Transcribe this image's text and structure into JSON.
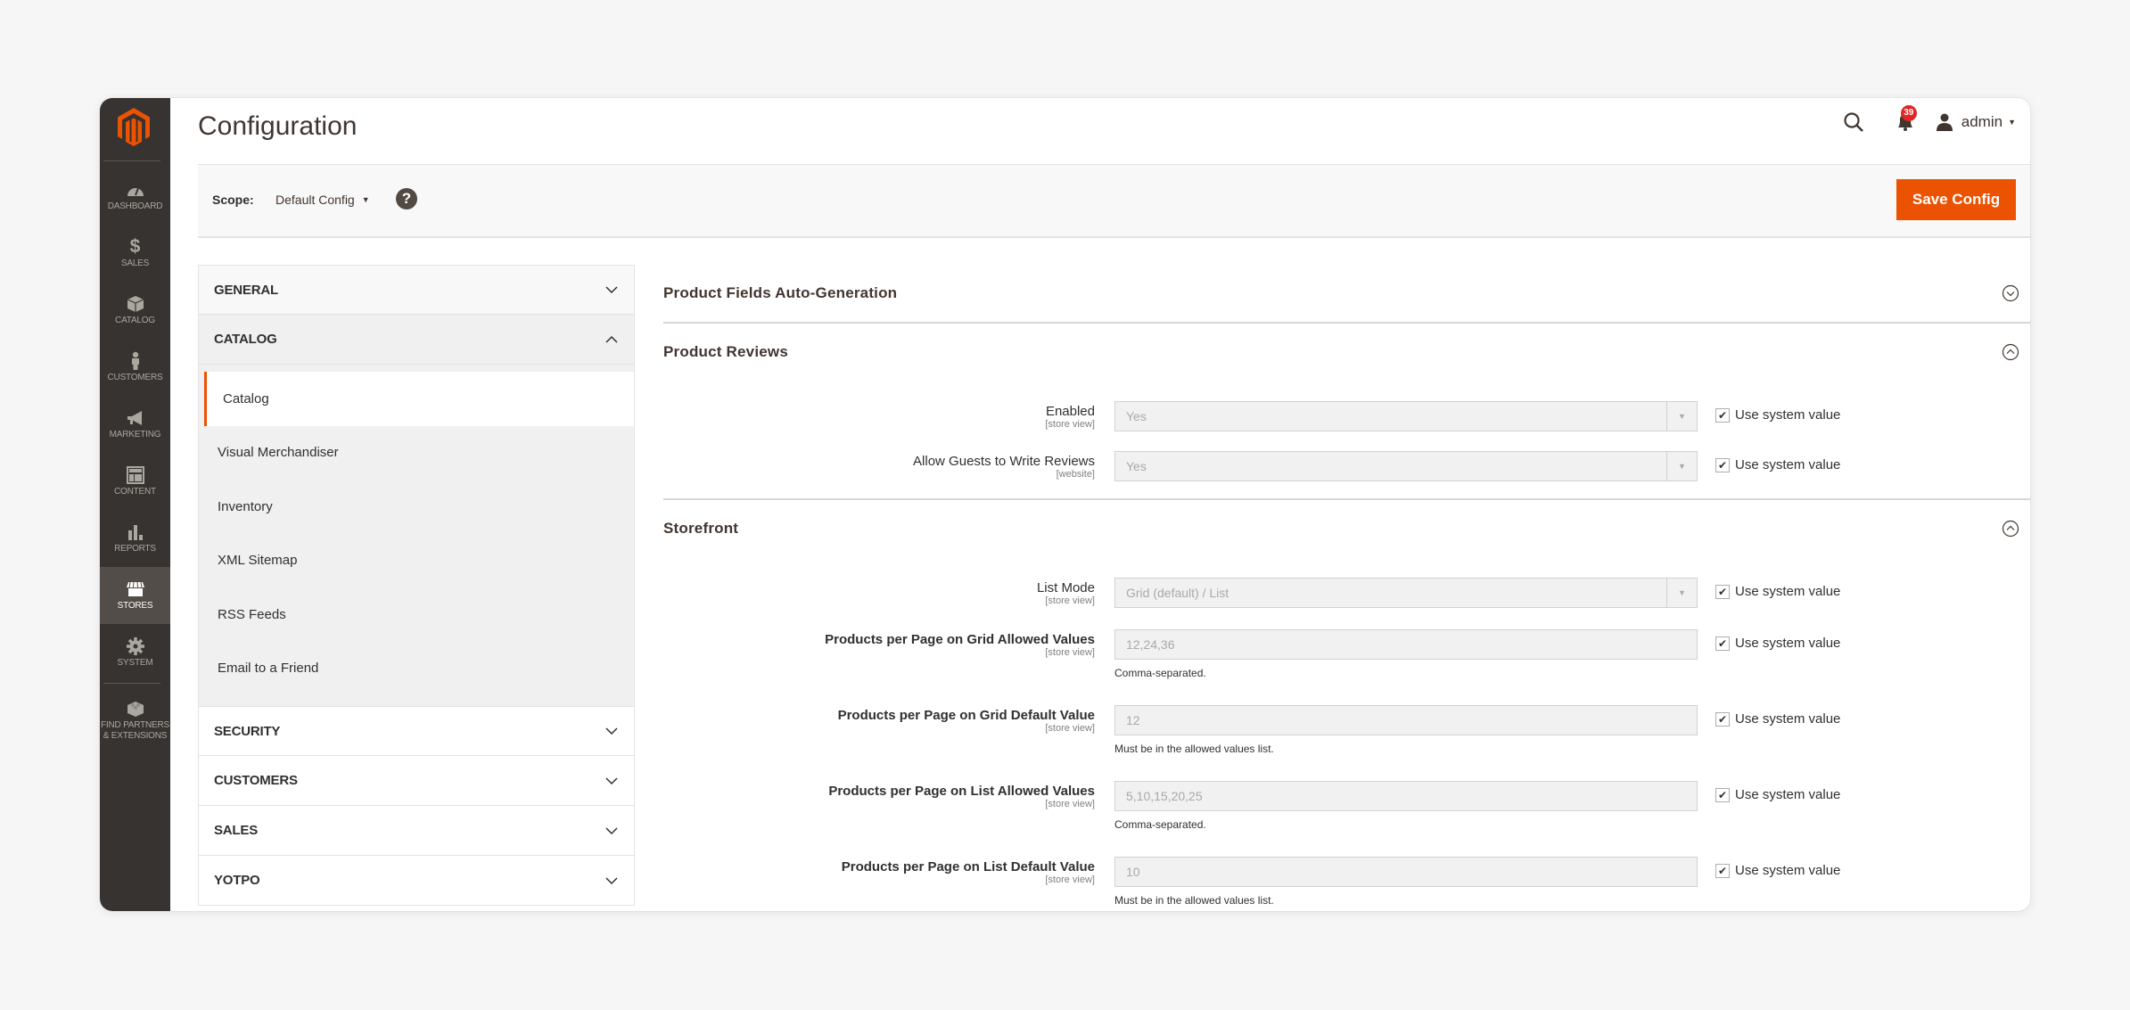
{
  "admin_menu": {
    "items": [
      {
        "label": "Dashboard",
        "icon": "dashboard-icon",
        "active": false
      },
      {
        "label": "Sales",
        "icon": "dollar-icon",
        "active": false
      },
      {
        "label": "Catalog",
        "icon": "box-icon",
        "active": false
      },
      {
        "label": "Customers",
        "icon": "person-icon",
        "active": false
      },
      {
        "label": "Marketing",
        "icon": "megaphone-icon",
        "active": false
      },
      {
        "label": "Content",
        "icon": "layout-icon",
        "active": false
      },
      {
        "label": "Reports",
        "icon": "bar-chart-icon",
        "active": false
      },
      {
        "label": "Stores",
        "icon": "storefront-icon",
        "active": true
      },
      {
        "label": "System",
        "icon": "gear-icon",
        "active": false
      },
      {
        "label_line1": "Find Partners",
        "label_line2": "& Extensions",
        "icon": "lego-brick-icon",
        "active": false
      }
    ]
  },
  "header": {
    "title": "Configuration",
    "notifications_count": "39",
    "user_name": "admin"
  },
  "scope": {
    "label": "Scope:",
    "value": "Default Config",
    "save_label": "Save Config"
  },
  "config_nav": {
    "groups_before": [
      {
        "label": "General",
        "open": false
      },
      {
        "label": "Catalog",
        "open": true
      }
    ],
    "catalog_items": [
      {
        "label": "Catalog",
        "active": true
      },
      {
        "label": "Visual Merchandiser",
        "active": false
      },
      {
        "label": "Inventory",
        "active": false
      },
      {
        "label": "XML Sitemap",
        "active": false
      },
      {
        "label": "RSS Feeds",
        "active": false
      },
      {
        "label": "Email to a Friend",
        "active": false
      }
    ],
    "groups_after": [
      {
        "label": "Security"
      },
      {
        "label": "Customers"
      },
      {
        "label": "Sales"
      },
      {
        "label": "Yotpo"
      }
    ]
  },
  "sections": {
    "auto_generation": {
      "title": "Product Fields Auto-Generation",
      "expanded": false
    },
    "product_reviews": {
      "title": "Product Reviews",
      "expanded": true,
      "fields": [
        {
          "label": "Enabled",
          "scope": "[store view]",
          "type": "select",
          "value": "Yes",
          "inherit_label": "Use system value",
          "inherit": true
        },
        {
          "label": "Allow Guests to Write Reviews",
          "scope": "[website]",
          "type": "select",
          "value": "Yes",
          "inherit_label": "Use system value",
          "inherit": true
        }
      ]
    },
    "storefront": {
      "title": "Storefront",
      "expanded": true,
      "fields": [
        {
          "label": "List Mode",
          "scope": "[store view]",
          "type": "select",
          "value": "Grid (default) / List",
          "inherit_label": "Use system value",
          "inherit": true
        },
        {
          "label": "Products per Page on Grid Allowed Values",
          "scope": "[store view]",
          "type": "text",
          "value": "12,24,36",
          "note": "Comma-separated.",
          "inherit_label": "Use system value",
          "inherit": true
        },
        {
          "label": "Products per Page on Grid Default Value",
          "scope": "[store view]",
          "type": "text",
          "value": "12",
          "note": "Must be in the allowed values list.",
          "inherit_label": "Use system value",
          "inherit": true
        },
        {
          "label": "Products per Page on List Allowed Values",
          "scope": "[store view]",
          "type": "text",
          "value": "5,10,15,20,25",
          "note": "Comma-separated.",
          "inherit_label": "Use system value",
          "inherit": true
        },
        {
          "label": "Products per Page on List Default Value",
          "scope": "[store view]",
          "type": "text",
          "value": "10",
          "note": "Must be in the allowed values list.",
          "inherit_label": "Use system value",
          "inherit": true
        }
      ]
    }
  },
  "colors": {
    "brand_orange": "#eb5202",
    "menu_bg": "#373330",
    "menu_active_bg": "#524d49",
    "badge_red": "#e22626"
  }
}
